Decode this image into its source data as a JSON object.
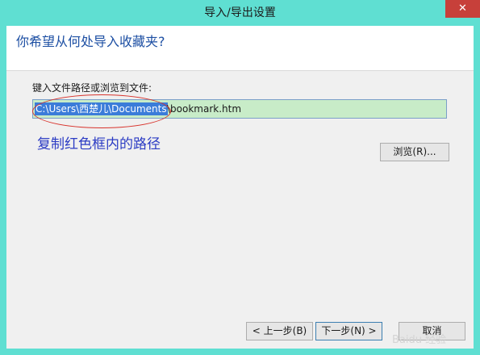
{
  "window": {
    "title": "导入/导出设置",
    "close_label": "✕"
  },
  "header": {
    "question": "你希望从何处导入收藏夹?"
  },
  "field": {
    "label": "键入文件路径或浏览到文件:",
    "value_selected": "C:\\Users\\西楚儿\\Documents",
    "value_rest": "\\bookmark.htm"
  },
  "annotation": {
    "note": "复制红色框内的路径"
  },
  "buttons": {
    "browse": "浏览(R)...",
    "back": "< 上一步(B)",
    "next": "下一步(N) >",
    "cancel": "取消"
  },
  "watermark": "Baidu 经验"
}
